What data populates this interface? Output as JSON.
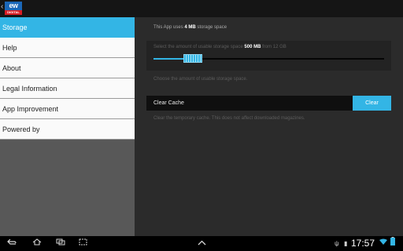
{
  "app": {
    "logo_main": "ew",
    "logo_sub": "DIGITAL"
  },
  "sidebar": {
    "items": [
      {
        "label": "Storage",
        "active": true
      },
      {
        "label": "Help",
        "active": false
      },
      {
        "label": "About",
        "active": false
      },
      {
        "label": "Legal Information",
        "active": false
      },
      {
        "label": "App Improvement",
        "active": false
      },
      {
        "label": "Powered by",
        "active": false
      }
    ]
  },
  "storage": {
    "usage_prefix": "This App uses ",
    "usage_value": "4 MB",
    "usage_suffix": " storage space",
    "slider_prefix": "Select the amount of usable storage space ",
    "slider_value": "500 MB",
    "slider_suffix": " from 12 GB",
    "slider_level_percent": 17,
    "hint": "Choose the amount of usable storage space.",
    "clear_cache_label": "Clear Cache",
    "clear_button": "Clear",
    "clear_hint": "Clear the temporary cache. This does not affect downloaded magazines."
  },
  "system": {
    "time": "17:57",
    "nav_icons": [
      "back-icon",
      "home-icon",
      "recent-apps-icon",
      "screenshot-icon",
      "up-chevron-icon"
    ],
    "status_icons": [
      "usb-icon",
      "sd-card-icon",
      "wifi-icon",
      "battery-icon"
    ]
  },
  "colors": {
    "accent": "#33b5e5",
    "sidebar_bg": "#585858",
    "content_bg": "#2b2b2b"
  }
}
